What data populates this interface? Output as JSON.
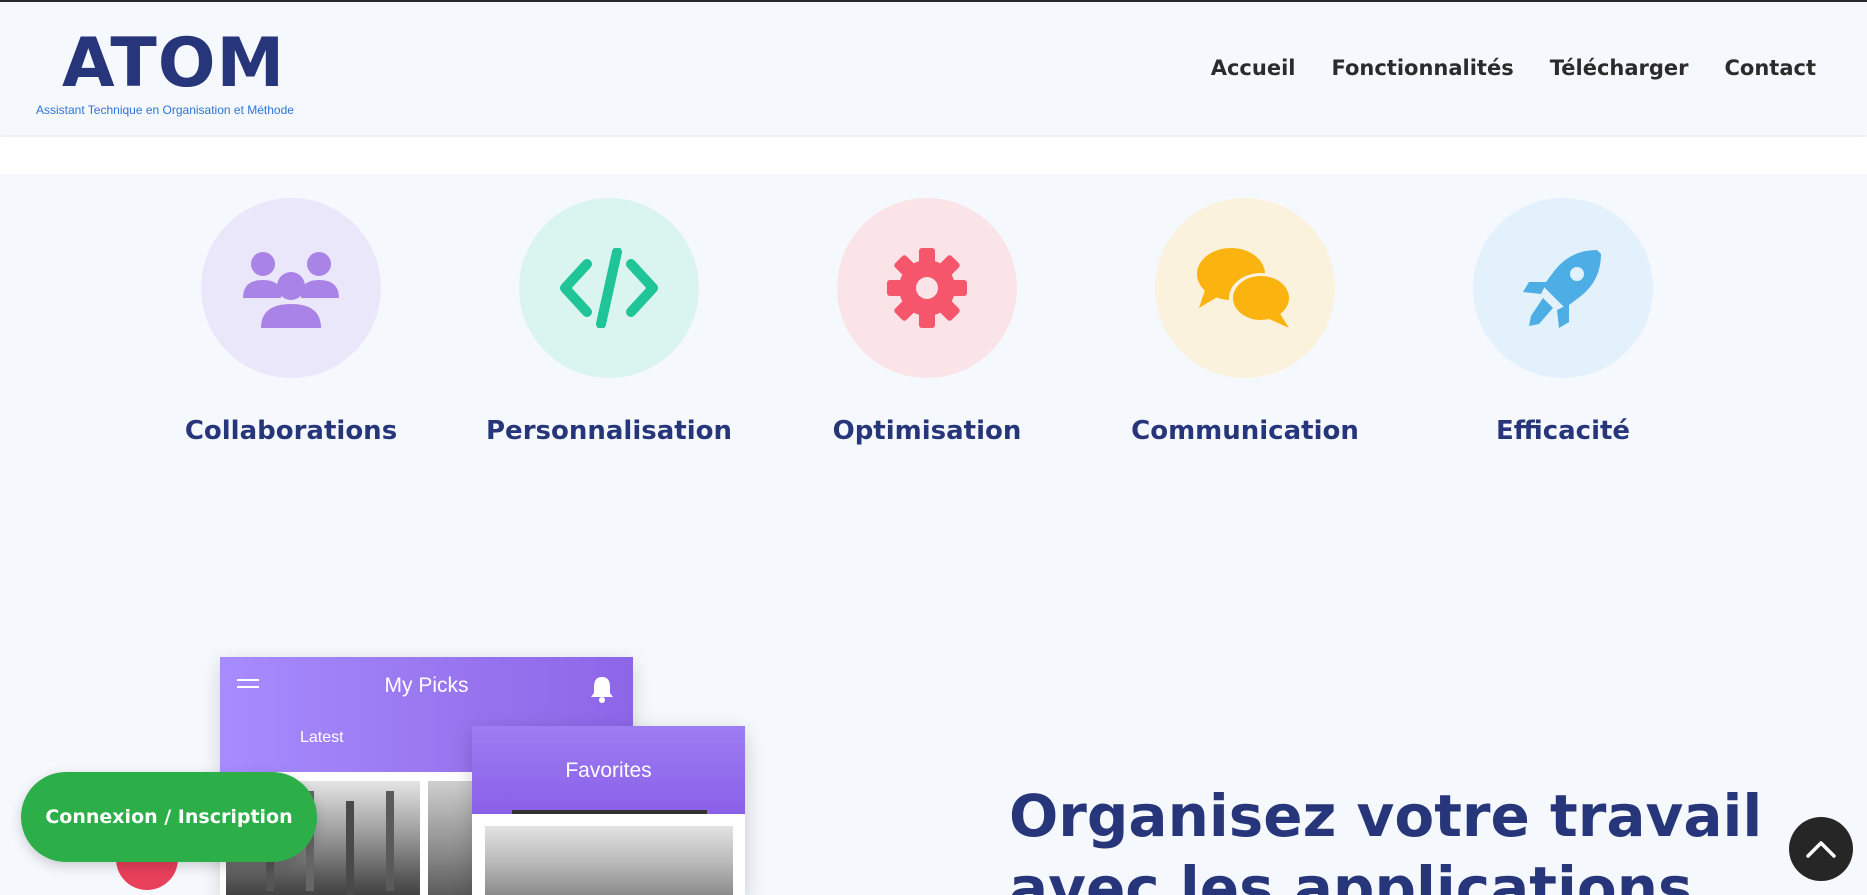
{
  "header": {
    "logo": "ATOM",
    "tagline": "Assistant Technique en Organisation et Méthode",
    "nav": [
      {
        "label": "Accueil"
      },
      {
        "label": "Fonctionnalités"
      },
      {
        "label": "Télécharger"
      },
      {
        "label": "Contact"
      }
    ]
  },
  "features": [
    {
      "title": "Collaborations",
      "icon": "users-icon",
      "bg": "#ebe7fa",
      "color": "#a984e6"
    },
    {
      "title": "Personnalisation",
      "icon": "code-icon",
      "bg": "#daf5ef",
      "color": "#1fc497"
    },
    {
      "title": "Optimisation",
      "icon": "gear-icon",
      "bg": "#fbe4e8",
      "color": "#f5566c"
    },
    {
      "title": "Communication",
      "icon": "chat-icon",
      "bg": "#fbf2dd",
      "color": "#fbb40f"
    },
    {
      "title": "Efficacité",
      "icon": "rocket-icon",
      "bg": "#e2f1fb",
      "color": "#4daee6"
    }
  ],
  "mockup": {
    "phone1_title": "My Picks",
    "phone1_tab": "Latest",
    "phone2_title": "Favorites"
  },
  "section": {
    "headline_line1": "Organisez votre travail",
    "headline_line2": "avec les applications"
  },
  "buttons": {
    "login": "Connexion / Inscription"
  },
  "colors": {
    "brand": "#27367a",
    "accent_green": "#2cae48",
    "purple": "#9a78f0"
  }
}
